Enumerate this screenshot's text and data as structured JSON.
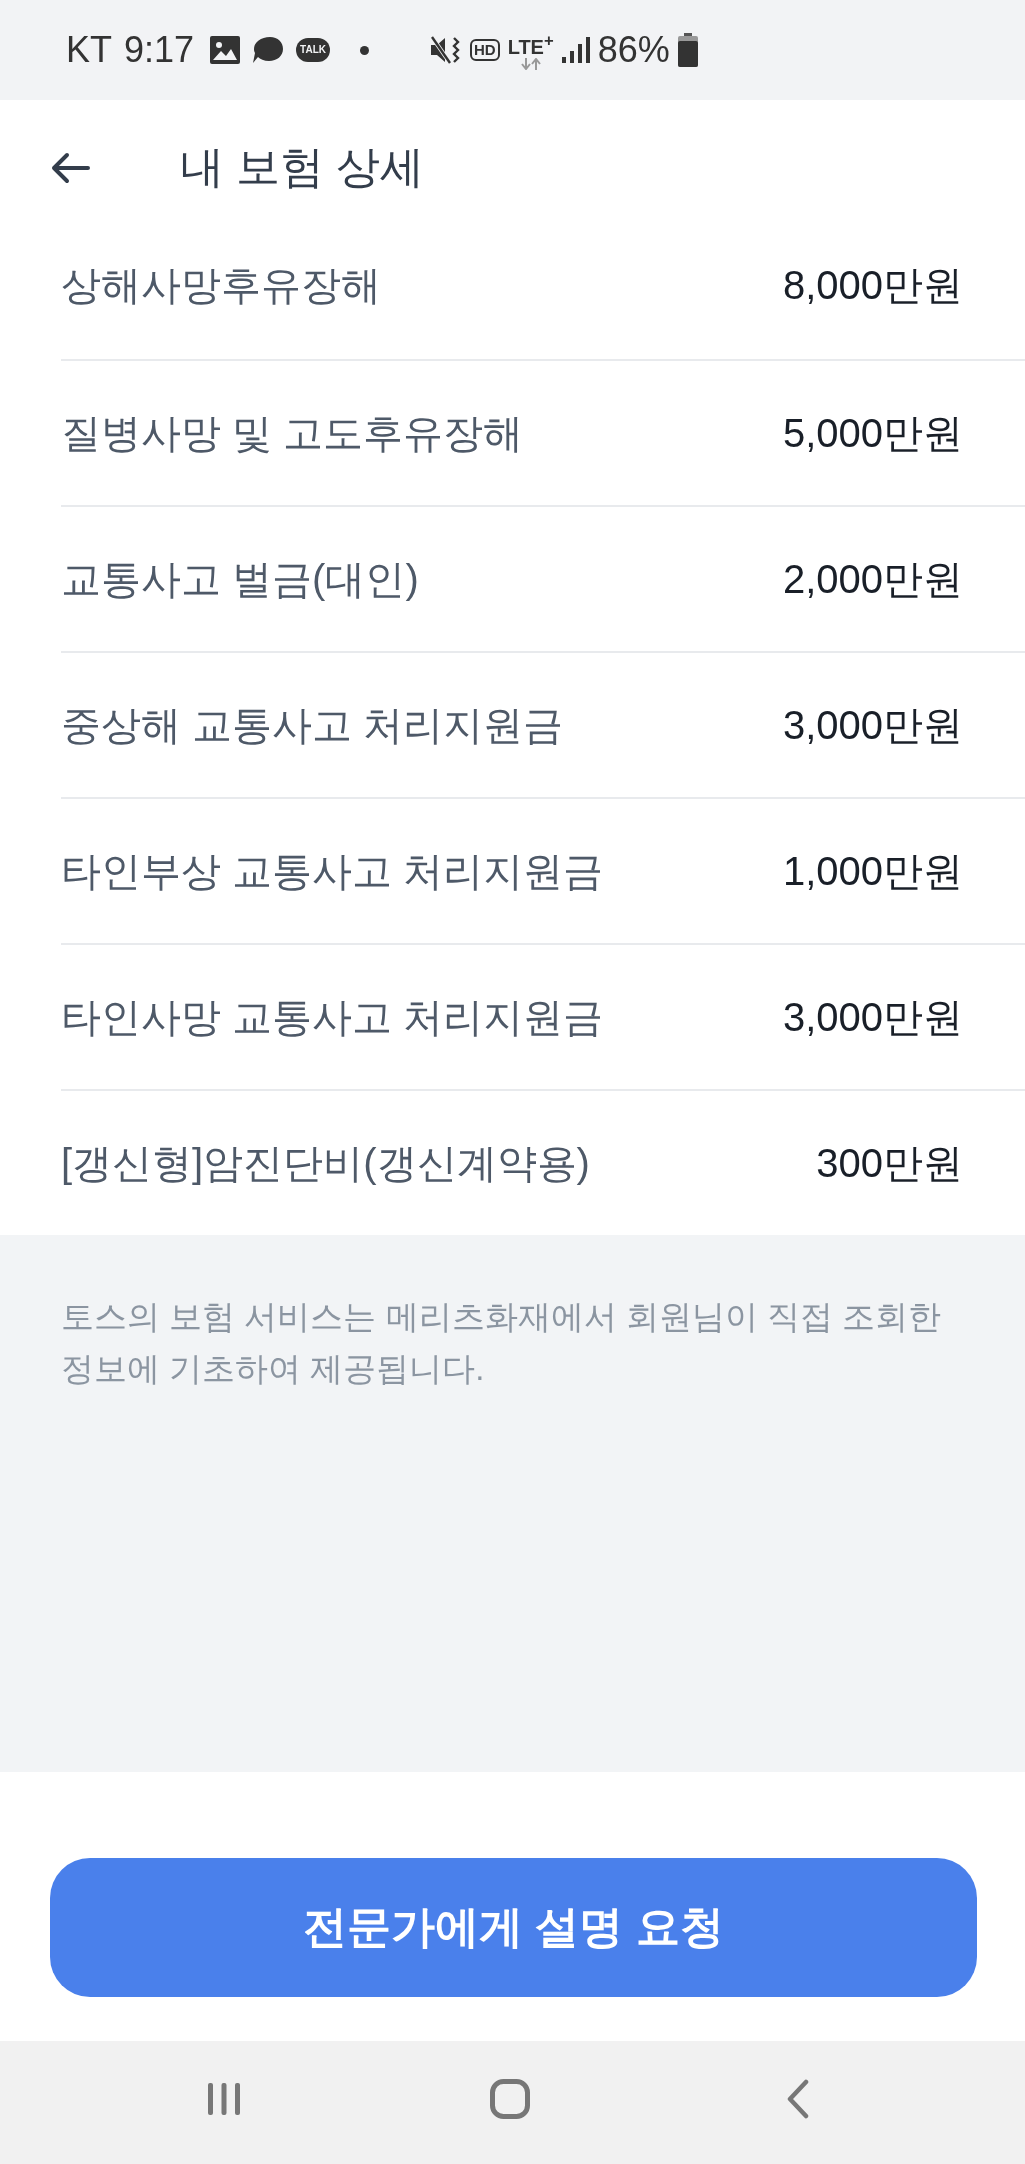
{
  "status_bar": {
    "carrier": "KT",
    "time": "9:17",
    "talk_badge": "TALK",
    "hd_badge": "HD",
    "network": "LTE$^{+}$",
    "battery": "86%"
  },
  "header": {
    "title": "내 보험 상세"
  },
  "coverages": [
    {
      "name": "상해사망후유장해",
      "amount": "8,000만원"
    },
    {
      "name": "질병사망 및 고도후유장해",
      "amount": "5,000만원"
    },
    {
      "name": "교통사고 벌금(대인)",
      "amount": "2,000만원"
    },
    {
      "name": "중상해 교통사고 처리지원금",
      "amount": "3,000만원"
    },
    {
      "name": "타인부상 교통사고 처리지원금",
      "amount": "1,000만원"
    },
    {
      "name": "타인사망 교통사고 처리지원금",
      "amount": "3,000만원"
    },
    {
      "name": "[갱신형]암진단비(갱신계약용)",
      "amount": "300만원"
    }
  ],
  "notice": "토스의 보험 서비스는 메리츠화재에서 회원님이 직접 조회한\n정보에 기초하여 제공됩니다.",
  "cta_button": {
    "label": "전문가에게 설명 요청"
  }
}
